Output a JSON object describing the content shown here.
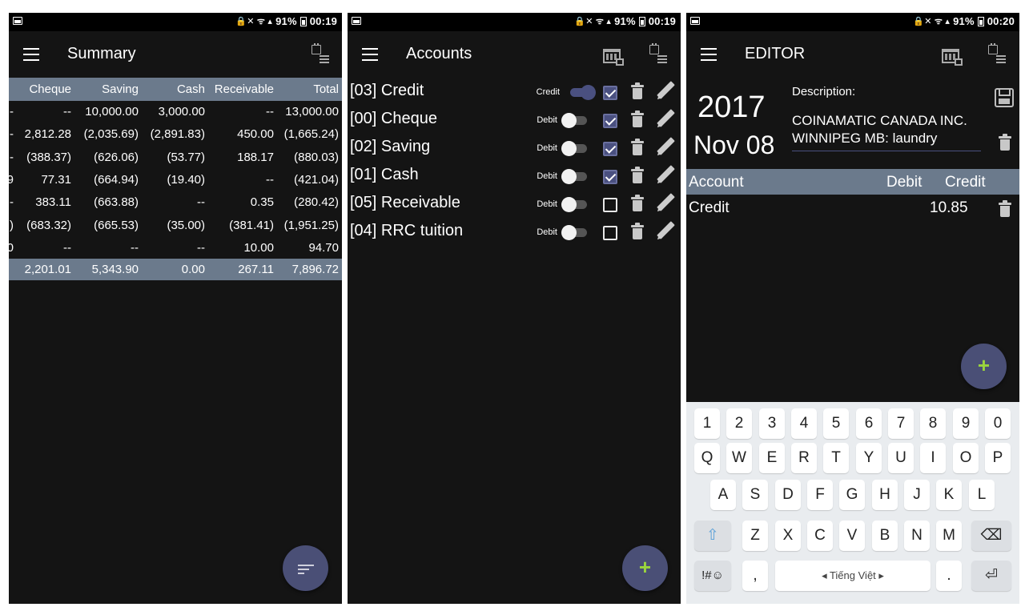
{
  "status": {
    "battery": "91%",
    "screens": [
      {
        "time": "00:19"
      },
      {
        "time": "00:19"
      },
      {
        "time": "00:20"
      }
    ]
  },
  "summary": {
    "title": "Summary",
    "columns": [
      "Cheque",
      "Saving",
      "Cash",
      "Receivable",
      "Total"
    ],
    "rows": [
      {
        "cut": "-",
        "cells": [
          "--",
          "10,000.00",
          "3,000.00",
          "--",
          "13,000.00"
        ]
      },
      {
        "cut": "-",
        "cells": [
          "2,812.28",
          "(2,035.69)",
          "(2,891.83)",
          "450.00",
          "(1,665.24)"
        ]
      },
      {
        "cut": "-",
        "cells": [
          "(388.37)",
          "(626.06)",
          "(53.77)",
          "188.17",
          "(880.03)"
        ]
      },
      {
        "cut": "9",
        "cells": [
          "77.31",
          "(664.94)",
          "(19.40)",
          "--",
          "(421.04)"
        ]
      },
      {
        "cut": "-",
        "cells": [
          "383.11",
          "(663.88)",
          "--",
          "0.35",
          "(280.42)"
        ]
      },
      {
        "cut": ")",
        "cells": [
          "(683.32)",
          "(665.53)",
          "(35.00)",
          "(381.41)",
          "(1,951.25)"
        ]
      },
      {
        "cut": "0",
        "cells": [
          "--",
          "--",
          "--",
          "10.00",
          "94.70"
        ]
      }
    ],
    "totals": [
      "2,201.01",
      "5,343.90",
      "0.00",
      "267.11",
      "7,896.72"
    ]
  },
  "accounts": {
    "title": "Accounts",
    "items": [
      {
        "name": "[03] Credit",
        "type": "Credit",
        "switch_on": true,
        "checked": true
      },
      {
        "name": "[00] Cheque",
        "type": "Debit",
        "switch_on": false,
        "checked": true
      },
      {
        "name": "[02] Saving",
        "type": "Debit",
        "switch_on": false,
        "checked": true
      },
      {
        "name": "[01] Cash",
        "type": "Debit",
        "switch_on": false,
        "checked": true
      },
      {
        "name": "[05] Receivable",
        "type": "Debit",
        "switch_on": false,
        "checked": false
      },
      {
        "name": "[04] RRC tuition",
        "type": "Debit",
        "switch_on": false,
        "checked": false
      }
    ],
    "fab_label": "+"
  },
  "editor": {
    "title": "EDITOR",
    "year": "2017",
    "date": "Nov 08",
    "description_label": "Description:",
    "description_line1": "COINAMATIC CANADA INC.",
    "description_line2": "WINNIPEG MB: laundry",
    "columns": {
      "account": "Account",
      "debit": "Debit",
      "credit": "Credit"
    },
    "entry": {
      "account": "Credit",
      "debit": "",
      "credit": "10.85"
    },
    "fab_label": "+"
  },
  "keyboard": {
    "row1": [
      "1",
      "2",
      "3",
      "4",
      "5",
      "6",
      "7",
      "8",
      "9",
      "0"
    ],
    "row2": [
      "Q",
      "W",
      "E",
      "R",
      "T",
      "Y",
      "U",
      "I",
      "O",
      "P"
    ],
    "row3": [
      "A",
      "S",
      "D",
      "F",
      "G",
      "H",
      "J",
      "K",
      "L"
    ],
    "row4": [
      "Z",
      "X",
      "C",
      "V",
      "B",
      "N",
      "M"
    ],
    "symbols": "!#☺",
    "comma": ",",
    "period": ".",
    "space_label": "◂ Tiếng Việt ▸",
    "shift": "⇧",
    "backspace": "⌫",
    "enter": "⏎"
  }
}
